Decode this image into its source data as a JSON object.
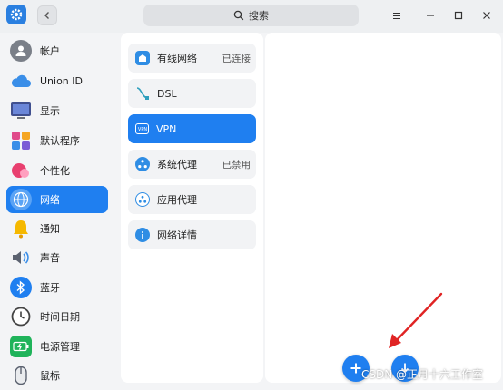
{
  "header": {
    "search_label": "搜索"
  },
  "sidebar": {
    "items": [
      {
        "label": "帐户",
        "icon": "account-icon"
      },
      {
        "label": "Union ID",
        "icon": "cloud-icon"
      },
      {
        "label": "显示",
        "icon": "display-icon"
      },
      {
        "label": "默认程序",
        "icon": "default-apps-icon"
      },
      {
        "label": "个性化",
        "icon": "personalization-icon"
      },
      {
        "label": "网络",
        "icon": "network-globe-icon",
        "active": true
      },
      {
        "label": "通知",
        "icon": "bell-icon"
      },
      {
        "label": "声音",
        "icon": "speaker-icon"
      },
      {
        "label": "蓝牙",
        "icon": "bluetooth-icon"
      },
      {
        "label": "时间日期",
        "icon": "clock-icon"
      },
      {
        "label": "电源管理",
        "icon": "battery-icon"
      },
      {
        "label": "鼠标",
        "icon": "mouse-icon"
      }
    ]
  },
  "network_menu": {
    "items": [
      {
        "label": "有线网络",
        "status": "已连接",
        "icon": "wired-network-icon"
      },
      {
        "label": "DSL",
        "status": "",
        "icon": "dsl-icon"
      },
      {
        "label": "VPN",
        "status": "",
        "icon": "vpn-icon",
        "active": true
      },
      {
        "label": "系统代理",
        "status": "已禁用",
        "icon": "system-proxy-icon"
      },
      {
        "label": "应用代理",
        "status": "",
        "icon": "app-proxy-icon"
      },
      {
        "label": "网络详情",
        "status": "",
        "icon": "info-icon"
      }
    ]
  },
  "watermark": "CSDN @正月十六工作室",
  "colors": {
    "accent": "#1f7ff0",
    "annotation_arrow": "#e02424"
  }
}
